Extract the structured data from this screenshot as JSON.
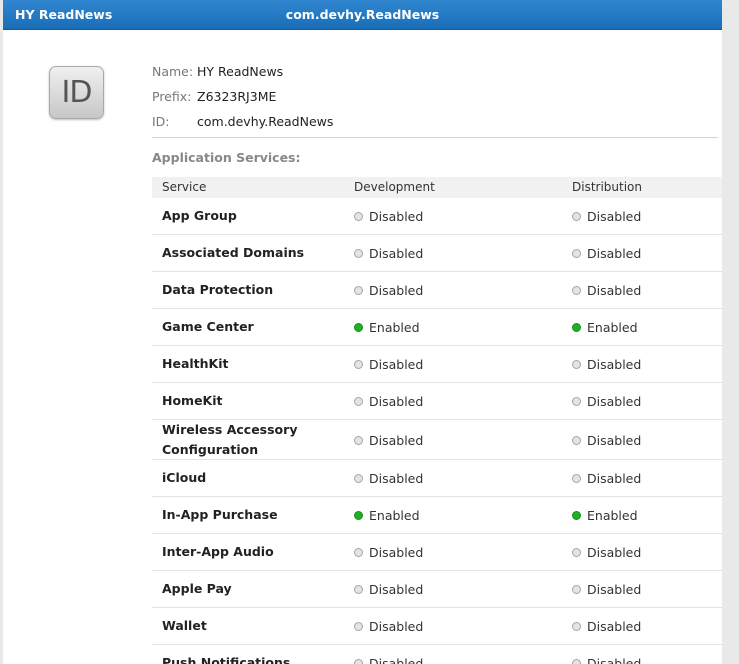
{
  "header": {
    "app_name": "HY ReadNews",
    "bundle_title": "com.devhy.ReadNews"
  },
  "icon": {
    "label": "ID"
  },
  "meta": {
    "name_label": "Name:",
    "name_value": "HY ReadNews",
    "prefix_label": "Prefix:",
    "prefix_value": "Z6323RJ3ME",
    "id_label": "ID:",
    "id_value": "com.devhy.ReadNews"
  },
  "services_label": "Application Services:",
  "table": {
    "columns": [
      "Service",
      "Development",
      "Distribution"
    ],
    "rows": [
      {
        "service": "App Group",
        "development": "Disabled",
        "distribution": "Disabled"
      },
      {
        "service": "Associated Domains",
        "development": "Disabled",
        "distribution": "Disabled"
      },
      {
        "service": "Data Protection",
        "development": "Disabled",
        "distribution": "Disabled"
      },
      {
        "service": "Game Center",
        "development": "Enabled",
        "distribution": "Enabled"
      },
      {
        "service": "HealthKit",
        "development": "Disabled",
        "distribution": "Disabled"
      },
      {
        "service": "HomeKit",
        "development": "Disabled",
        "distribution": "Disabled"
      },
      {
        "service": "Wireless Accessory Configuration",
        "development": "Disabled",
        "distribution": "Disabled"
      },
      {
        "service": "iCloud",
        "development": "Disabled",
        "distribution": "Disabled"
      },
      {
        "service": "In-App Purchase",
        "development": "Enabled",
        "distribution": "Enabled"
      },
      {
        "service": "Inter-App Audio",
        "development": "Disabled",
        "distribution": "Disabled"
      },
      {
        "service": "Apple Pay",
        "development": "Disabled",
        "distribution": "Disabled"
      },
      {
        "service": "Wallet",
        "development": "Disabled",
        "distribution": "Disabled"
      },
      {
        "service": "Push Notifications",
        "development": "Disabled",
        "distribution": "Disabled"
      }
    ]
  },
  "colors": {
    "header": "#1f75c0",
    "enabled": "#1eb022",
    "disabled": "#e4e4e4"
  }
}
